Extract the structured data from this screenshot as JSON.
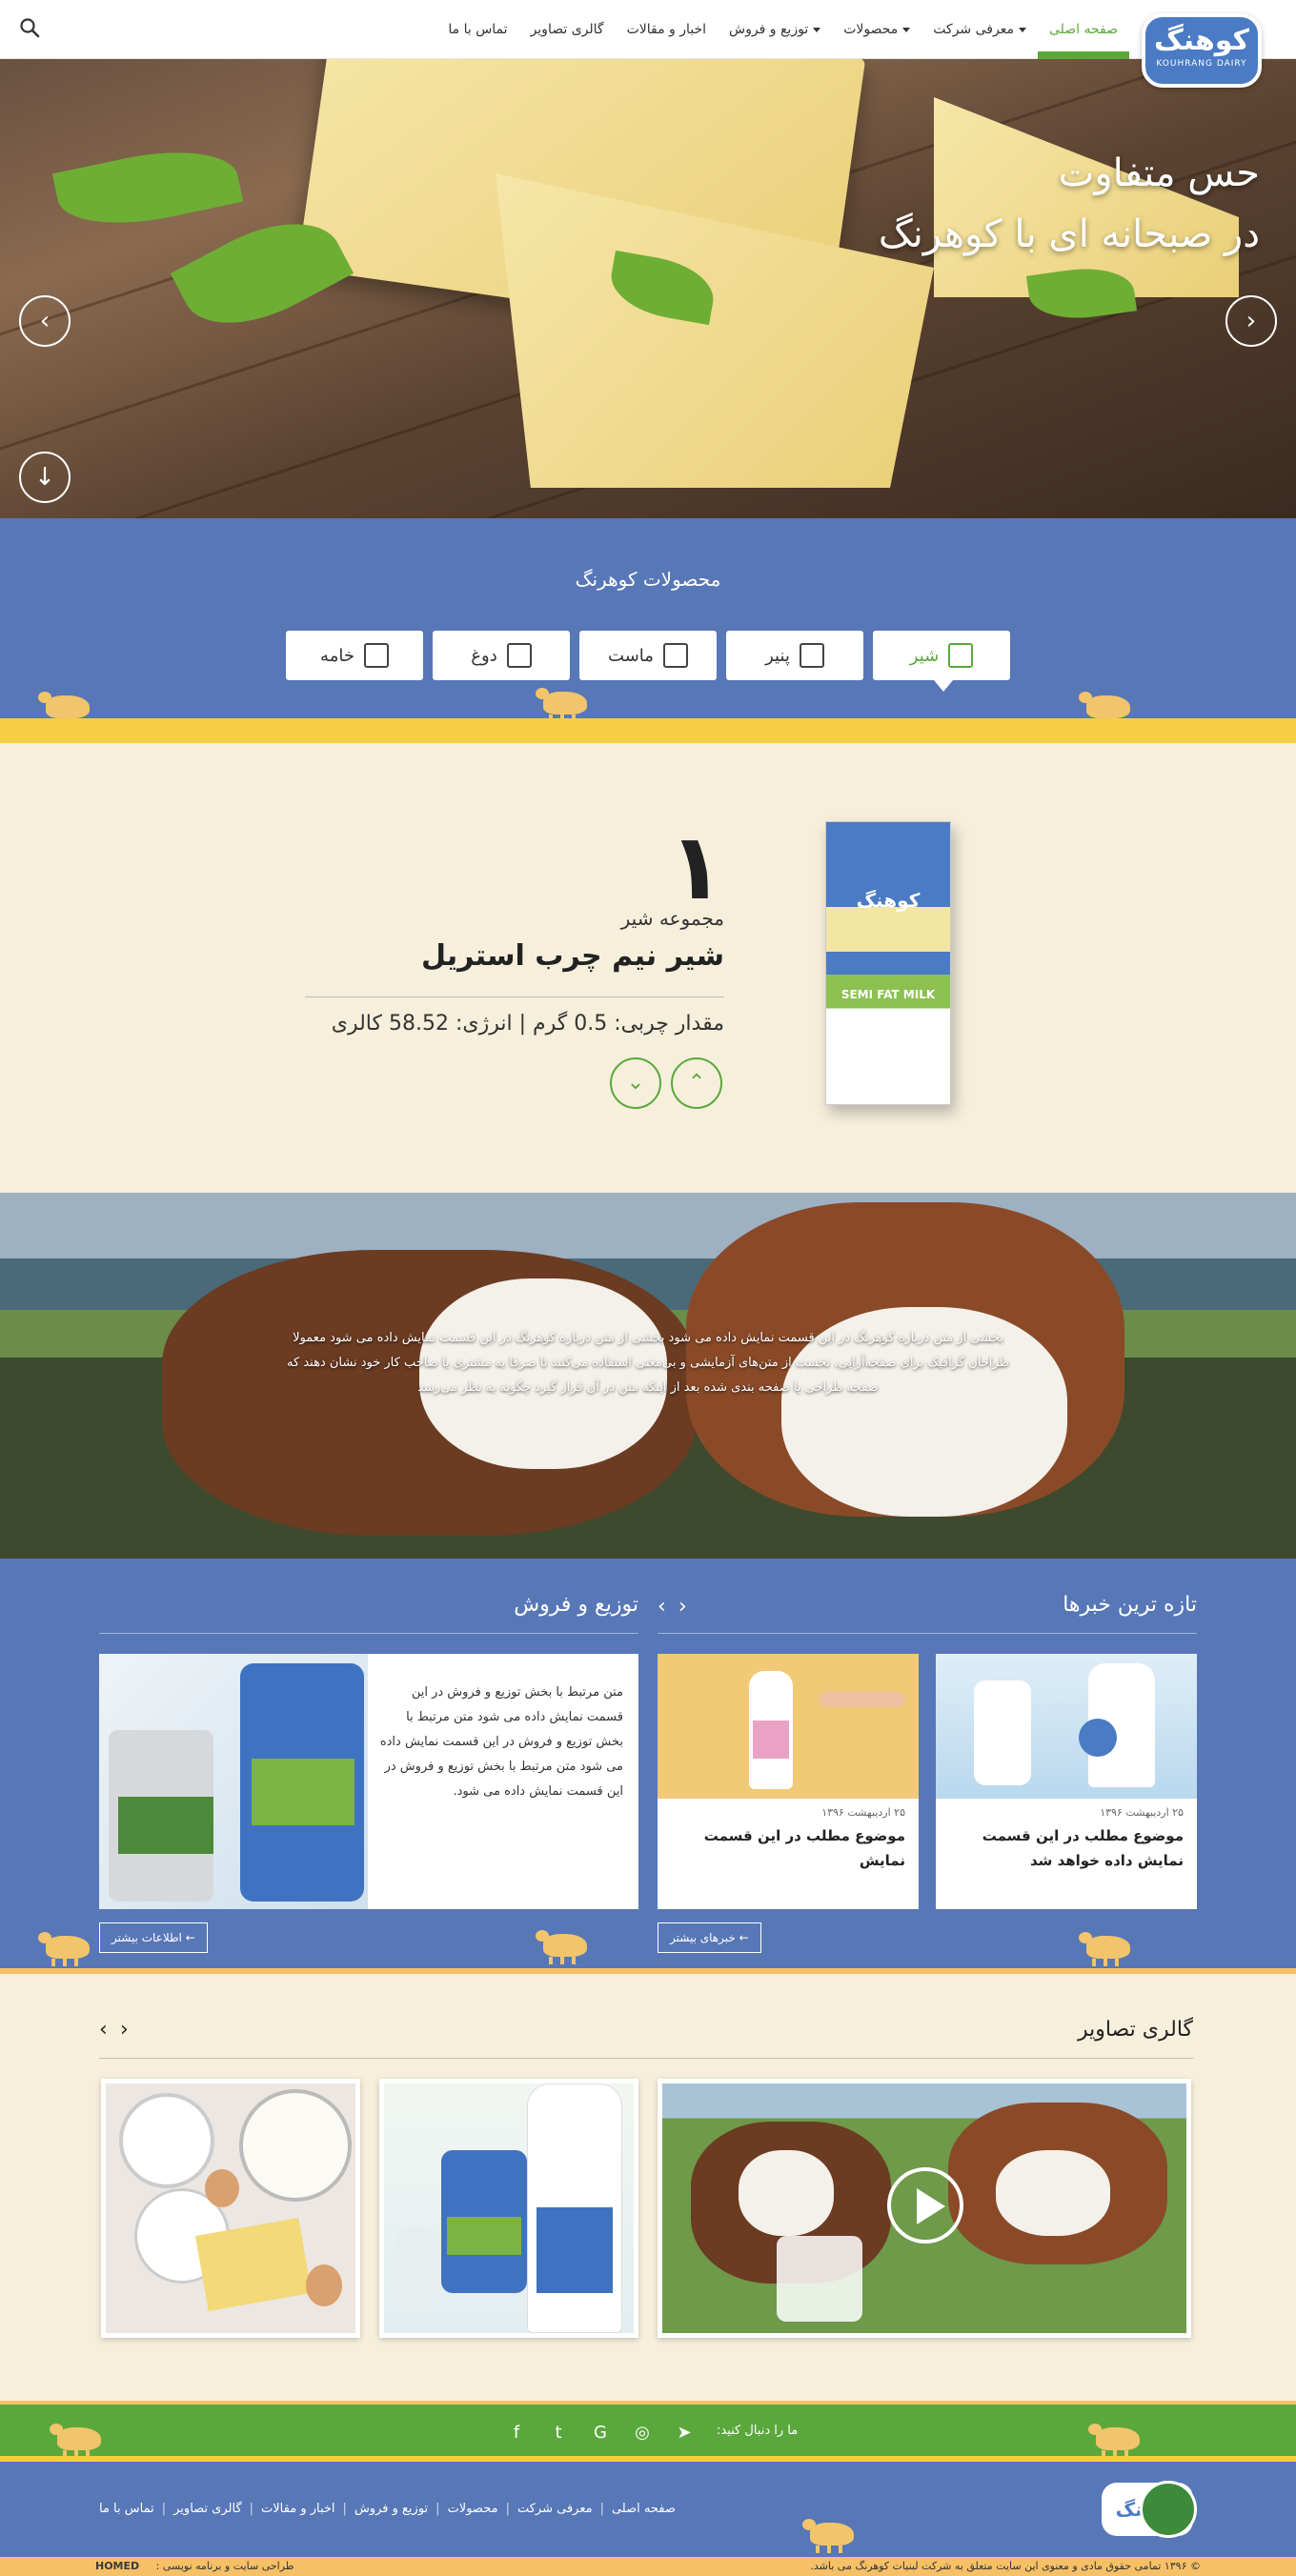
{
  "header": {
    "logo_text": "کوهنگ",
    "logo_sub": "KOUHRANG DAIRY",
    "nav": [
      {
        "label": "صفحه اصلی",
        "active": true,
        "dropdown": false
      },
      {
        "label": "معرفی شرکت",
        "active": false,
        "dropdown": true
      },
      {
        "label": "محصولات",
        "active": false,
        "dropdown": true
      },
      {
        "label": "توزیع و فروش",
        "active": false,
        "dropdown": true
      },
      {
        "label": "اخبار و مقالات",
        "active": false,
        "dropdown": false
      },
      {
        "label": "گالری تصاویر",
        "active": false,
        "dropdown": false
      },
      {
        "label": "تماس با ما",
        "active": false,
        "dropdown": false
      }
    ],
    "search_icon": "search-icon"
  },
  "hero": {
    "line1": "حس متفاوت",
    "line2": "در صبحانه ای با کوهرنگ",
    "prev": "‹",
    "next": "›",
    "scroll": "↓"
  },
  "products": {
    "title": "محصولات کوهرنگ",
    "tabs": [
      {
        "label": "شیر",
        "icon": "milk-carton-icon",
        "active": true
      },
      {
        "label": "پنیر",
        "icon": "cheese-icon",
        "active": false
      },
      {
        "label": "ماست",
        "icon": "yogurt-cup-icon",
        "active": false
      },
      {
        "label": "دوغ",
        "icon": "bottle-icon",
        "active": false
      },
      {
        "label": "خامه",
        "icon": "cream-icon",
        "active": false
      }
    ]
  },
  "showcase": {
    "number": "۱",
    "category": "مجموعه شیر",
    "name": "شیر نیم چرب استریل",
    "info": "مقدار چربی: 0.5 گرم | انرژی: 58.52 کالری",
    "pack_logo": "کوهنگ",
    "pack_text": "SEMI FAT MILK",
    "down": "⌄",
    "up": "⌃"
  },
  "about": {
    "text": "بخشی از متن درباره کوهرنگ در این قسمت نمایش داده می شود بخشی از متن درباره کوهرنگ در این قسمت نمایش داده می شود معمولا طراحان گرافیک برای صفحه‌آرایی، نخست از متن‌های آزمایشی و بی‌معنی استفاده می‌کنند تا صرفا به مشتری یا صاحب کار خود نشان دهند که صفحه طراحی یا صفحه بندی شده بعد از اینکه متن در آن قرار گیرد چگونه به نظر می‌رسد"
  },
  "news": {
    "title": "تازه ترین خبرها",
    "items": [
      {
        "date": "۲۵ اردیبهشت ۱۳۹۶",
        "title": "موضوع مطلب در این قسمت نمایش داده خواهد شد"
      },
      {
        "date": "۲۵ اردیبهشت ۱۳۹۶",
        "title": "موضوع مطلب در این قسمت نمایش"
      }
    ],
    "more": "خبرهای بیشتر",
    "prev": "‹",
    "next": "›"
  },
  "distribution": {
    "title": "توزیع و فروش",
    "text": "متن مرتبط با بخش توزیع و فروش در این قسمت نمایش داده می شود متن مرتبط با بخش توزیع و فروش در این قسمت نمایش داده می شود متن مرتبط با بخش توزیع و فروش در این قسمت نمایش داده می شود.",
    "more": "اطلاعات بیشتر"
  },
  "gallery": {
    "title": "گالری تصاویر",
    "play_icon": "play-icon",
    "prev": "‹",
    "next": "›"
  },
  "follow": {
    "label": "ما را دنبال کنید:",
    "icons": [
      "telegram-icon",
      "instagram-icon",
      "google-plus-icon",
      "twitter-icon",
      "facebook-icon"
    ],
    "glyphs": [
      "➤",
      "◎",
      "G",
      "t",
      "f"
    ]
  },
  "footer": {
    "nav": [
      "صفحه اصلی",
      "معرفی شرکت",
      "محصولات",
      "توزیع و فروش",
      "اخبار و مقالات",
      "گالری تصاویر",
      "تماس با ما"
    ],
    "logo_text": "کوهنگ",
    "copyright": "© ۱۳۹۶ تمامی حقوق مادی و معنوی این سایت متعلق به شرکت لبنیات کوهرنگ می باشد.",
    "credit": "طراحی سایت و برنامه نویسی :",
    "credit_brand": "HOMED"
  },
  "colors": {
    "primary_blue": "#5777b7",
    "accent_green": "#5aa83c",
    "stripe_yellow": "#f6ce45",
    "stripe_orange": "#f6c066",
    "cream": "#f6efdc"
  }
}
